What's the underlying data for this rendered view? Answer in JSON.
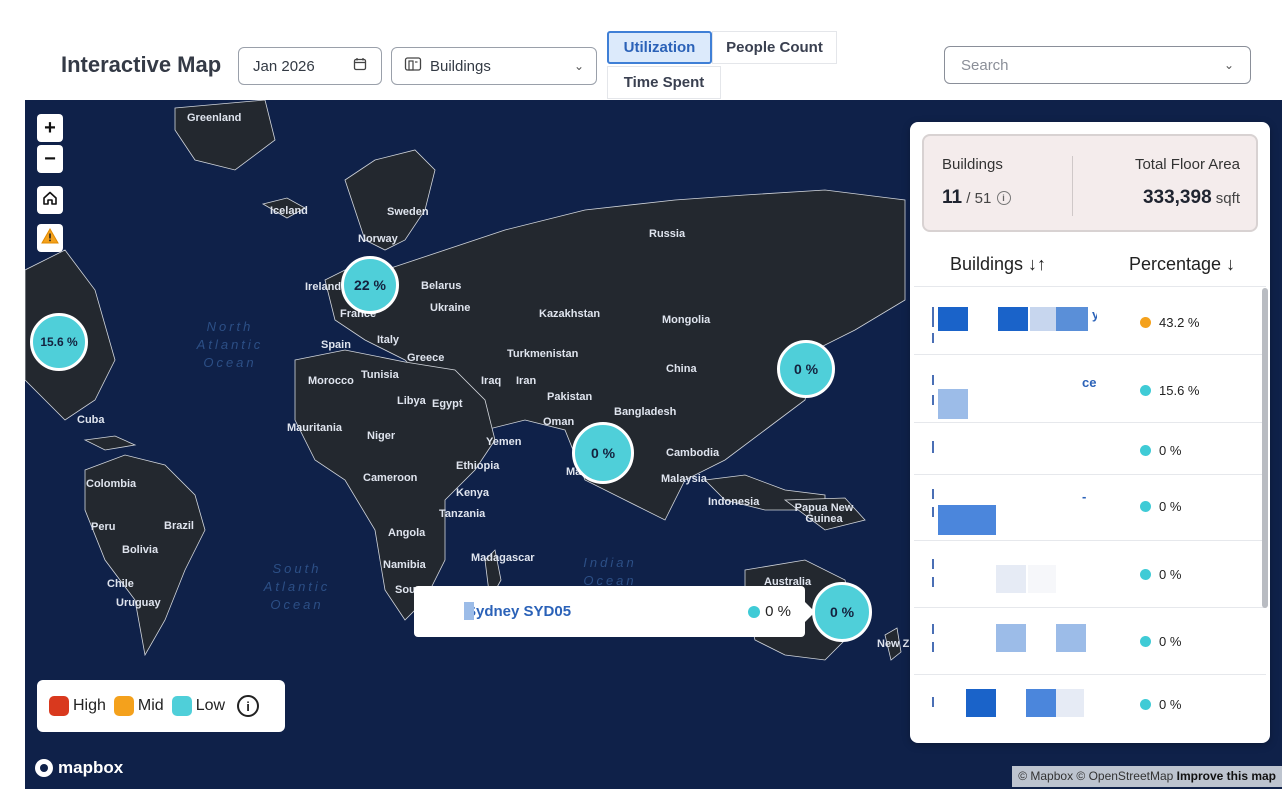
{
  "toolbar": {
    "title": "Interactive Map",
    "date": "Jan 2026",
    "building_filter": "Buildings",
    "tabs": [
      "Utilization",
      "People Count",
      "Time Spent"
    ],
    "active_tab": "Utilization",
    "search_placeholder": "Search"
  },
  "map": {
    "labels": [
      {
        "name": "Greenland"
      },
      {
        "name": "Iceland"
      },
      {
        "name": "Sweden"
      },
      {
        "name": "Norway"
      },
      {
        "name": "Russia"
      },
      {
        "name": "Ireland"
      },
      {
        "name": "Belarus"
      },
      {
        "name": "France"
      },
      {
        "name": "Ukraine"
      },
      {
        "name": "Kazakhstan"
      },
      {
        "name": "Mongolia"
      },
      {
        "name": "Spain"
      },
      {
        "name": "Italy"
      },
      {
        "name": "Greece"
      },
      {
        "name": "Turkmenistan"
      },
      {
        "name": "Morocco"
      },
      {
        "name": "Tunisia"
      },
      {
        "name": "Iraq"
      },
      {
        "name": "Iran"
      },
      {
        "name": "China"
      },
      {
        "name": "Libya"
      },
      {
        "name": "Egypt"
      },
      {
        "name": "Pakistan"
      },
      {
        "name": "Bangladesh"
      },
      {
        "name": "Oman"
      },
      {
        "name": "Cuba"
      },
      {
        "name": "Mauritania"
      },
      {
        "name": "Niger"
      },
      {
        "name": "Yemen"
      },
      {
        "name": "Cambodia"
      },
      {
        "name": "Ethiopia"
      },
      {
        "name": "Colombia"
      },
      {
        "name": "Cameroon"
      },
      {
        "name": "Malaysia"
      },
      {
        "name": "Maldives"
      },
      {
        "name": "Kenya"
      },
      {
        "name": "Indonesia"
      },
      {
        "name": "Papua New Guinea"
      },
      {
        "name": "Peru"
      },
      {
        "name": "Brazil"
      },
      {
        "name": "Tanzania"
      },
      {
        "name": "Bolivia"
      },
      {
        "name": "Angola"
      },
      {
        "name": "Madagascar"
      },
      {
        "name": "Namibia"
      },
      {
        "name": "Chile"
      },
      {
        "name": "Australia"
      },
      {
        "name": "Uruguay"
      },
      {
        "name": "Sou"
      },
      {
        "name": "New Z"
      }
    ],
    "oceans": [
      {
        "name": "North Atlantic Ocean"
      },
      {
        "name": "South Atlantic Ocean"
      },
      {
        "name": "Indian Ocean"
      }
    ],
    "clusters": [
      {
        "label": "22 %",
        "value": 22
      },
      {
        "label": "15.6 %",
        "value": 15.6
      },
      {
        "label": "0 %",
        "value": 0
      },
      {
        "label": "0 %",
        "value": 0
      },
      {
        "label": "0 %",
        "value": 0
      }
    ],
    "popup": {
      "name": "Sydney SYD05",
      "value": "0 %"
    },
    "legend": {
      "items": [
        {
          "label": "High",
          "color": "#d9391e"
        },
        {
          "label": "Mid",
          "color": "#f4a11c"
        },
        {
          "label": "Low",
          "color": "#4fcfd9"
        }
      ]
    },
    "logo": "mapbox",
    "attribution": {
      "text": "© Mapbox © OpenStreetMap",
      "link": "Improve this map"
    }
  },
  "panel": {
    "buildings_label": "Buildings",
    "buildings_count": "11",
    "buildings_total": " / 51",
    "floor_area_label": "Total Floor Area",
    "floor_area_value": "333,398",
    "floor_area_unit": " sqft",
    "col_buildings": "Buildings ↓↑",
    "col_percentage": "Percentage ↓",
    "rows": [
      {
        "name_suffix": "y",
        "value": "43.2 %",
        "status": "Mid"
      },
      {
        "name_suffix": "ce",
        "value": "15.6 %",
        "status": "Low"
      },
      {
        "name_suffix": "",
        "value": "0 %",
        "status": "Low"
      },
      {
        "name_suffix": "-",
        "value": "0 %",
        "status": "Low"
      },
      {
        "name_suffix": "",
        "value": "0 %",
        "status": "Low"
      },
      {
        "name_suffix": "",
        "value": "0 %",
        "status": "Low"
      },
      {
        "name_suffix": "",
        "value": "0 %",
        "status": "Low"
      }
    ]
  },
  "colors": {
    "accent": "#2b62b8",
    "low": "#4fcfd9",
    "mid": "#f4a11c",
    "high": "#d9391e",
    "map_bg": "#0f2149"
  }
}
